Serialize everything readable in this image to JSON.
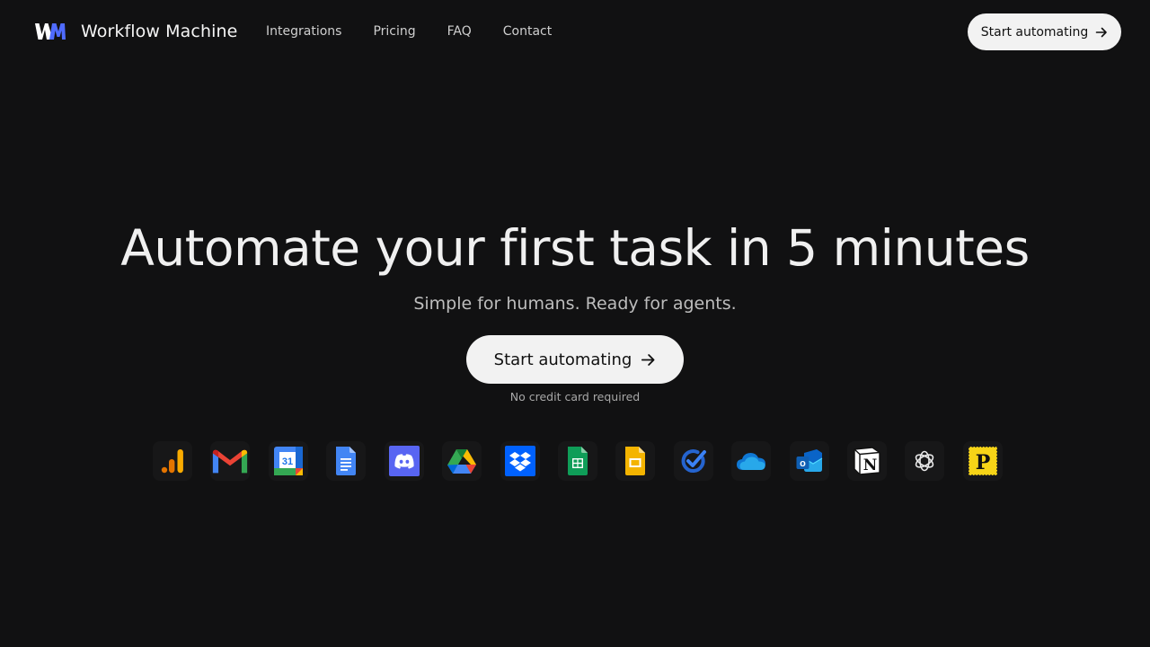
{
  "brand": {
    "name": "Workflow Machine",
    "logo_text": "WM",
    "logo_colors": [
      "#ffffff",
      "#4f6bff"
    ]
  },
  "nav": {
    "links": [
      {
        "label": "Integrations"
      },
      {
        "label": "Pricing"
      },
      {
        "label": "FAQ"
      },
      {
        "label": "Contact"
      }
    ],
    "cta_label": "Start automating"
  },
  "hero": {
    "title": "Automate your first task in 5 minutes",
    "subtitle": "Simple for humans. Ready for agents.",
    "cta_label": "Start automating",
    "note": "No credit card required"
  },
  "integrations": [
    {
      "name": "Google Analytics",
      "icon": "google-analytics-icon"
    },
    {
      "name": "Gmail",
      "icon": "gmail-icon"
    },
    {
      "name": "Google Calendar",
      "icon": "google-calendar-icon",
      "label": "31"
    },
    {
      "name": "Google Docs",
      "icon": "google-docs-icon"
    },
    {
      "name": "Discord",
      "icon": "discord-icon"
    },
    {
      "name": "Google Drive",
      "icon": "google-drive-icon"
    },
    {
      "name": "Dropbox",
      "icon": "dropbox-icon"
    },
    {
      "name": "Google Sheets",
      "icon": "google-sheets-icon"
    },
    {
      "name": "Google Slides",
      "icon": "google-slides-icon"
    },
    {
      "name": "Microsoft To Do",
      "icon": "microsoft-todo-icon"
    },
    {
      "name": "OneDrive",
      "icon": "onedrive-icon"
    },
    {
      "name": "Outlook",
      "icon": "outlook-icon",
      "label": "o"
    },
    {
      "name": "Notion",
      "icon": "notion-icon",
      "label": "N"
    },
    {
      "name": "OpenAI",
      "icon": "openai-icon"
    },
    {
      "name": "Product Hunt",
      "icon": "product-hunt-icon",
      "label": "P"
    }
  ],
  "colors": {
    "background": "#111112",
    "button_bg": "#f2f2f2",
    "button_text": "#111111",
    "text_primary": "#f0f0f0",
    "text_muted": "#bdbdbd"
  }
}
